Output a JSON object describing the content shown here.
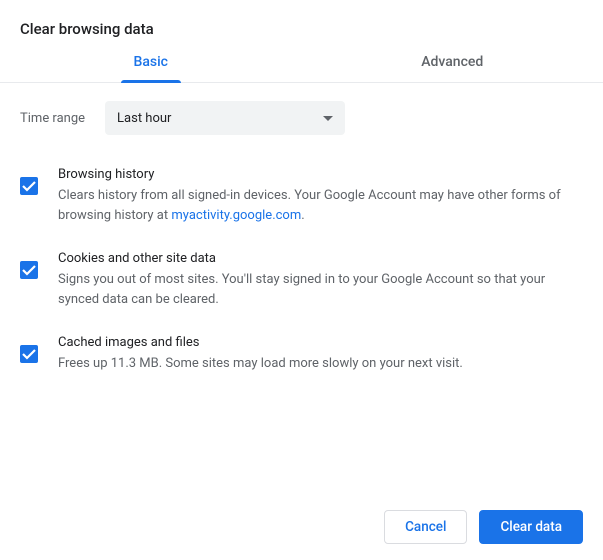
{
  "dialog": {
    "title": "Clear browsing data",
    "tabs": {
      "basic": "Basic",
      "advanced": "Advanced"
    },
    "time": {
      "label": "Time range",
      "value": "Last hour"
    },
    "items": [
      {
        "title": "Browsing history",
        "desc_prefix": "Clears history from all signed-in devices. Your Google Account may have other forms of browsing history at ",
        "link": "myactivity.google.com",
        "desc_suffix": ".",
        "checked": true
      },
      {
        "title": "Cookies and other site data",
        "desc": "Signs you out of most sites. You'll stay signed in to your Google Account so that your synced data can be cleared.",
        "checked": true
      },
      {
        "title": "Cached images and files",
        "desc": "Frees up 11.3 MB. Some sites may load more slowly on your next visit.",
        "checked": true
      }
    ],
    "buttons": {
      "cancel": "Cancel",
      "clear": "Clear data"
    }
  }
}
